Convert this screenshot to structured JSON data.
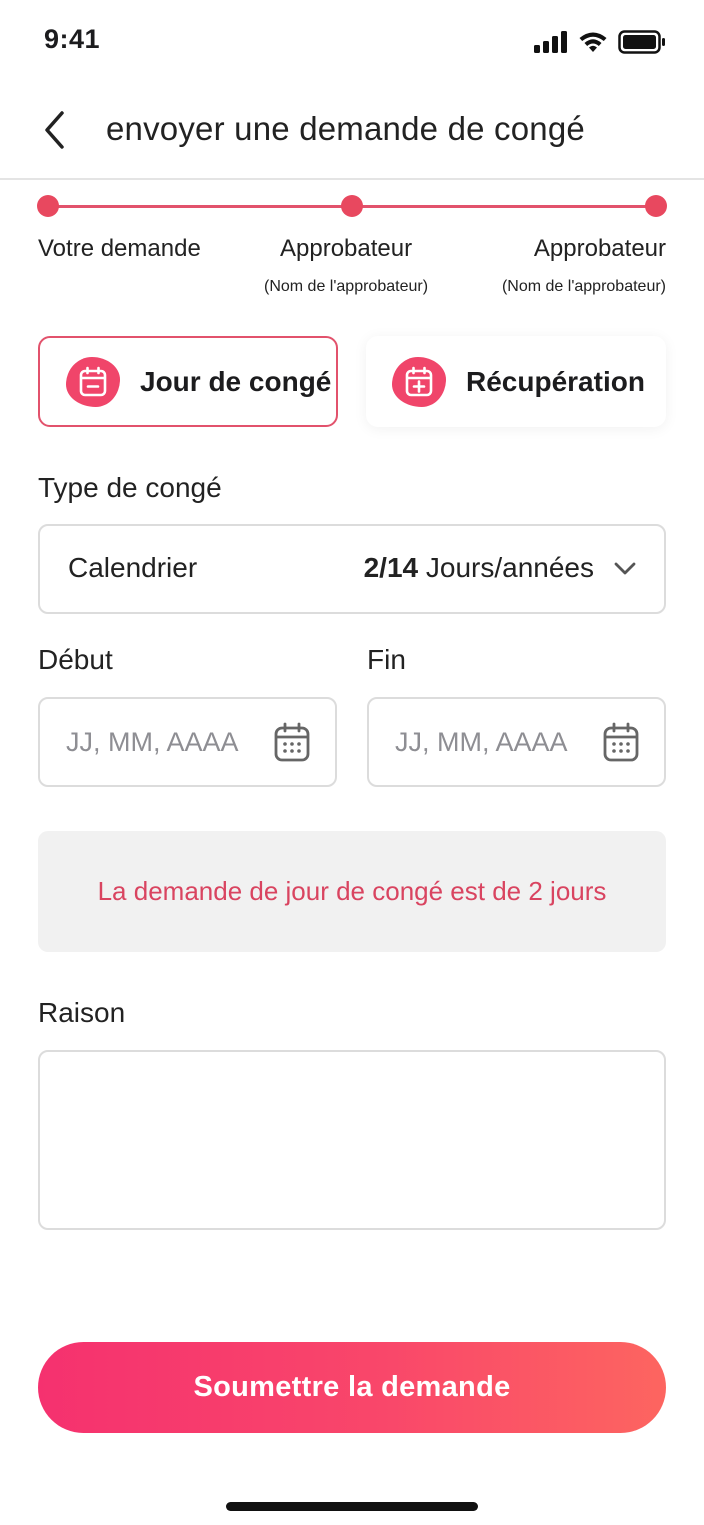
{
  "status_bar": {
    "time": "9:41",
    "icons": [
      "signal-icon",
      "wifi-icon",
      "battery-icon"
    ]
  },
  "header": {
    "title": "envoyer une demande de congé",
    "back_icon": "chevron-left-icon"
  },
  "stepper": {
    "steps": [
      {
        "label": "Votre demande",
        "sublabel": ""
      },
      {
        "label": "Approbateur",
        "sublabel": "(Nom de l'approbateur)"
      },
      {
        "label": "Approbateur",
        "sublabel": "(Nom de l'approbateur)"
      }
    ],
    "color": "#e8485f"
  },
  "leave_types": [
    {
      "label": "Jour de congé",
      "icon": "calendar-minus-icon",
      "selected": true
    },
    {
      "label": "Récupération",
      "icon": "calendar-plus-icon",
      "selected": false
    }
  ],
  "type_field": {
    "label": "Type de congé",
    "value": "Calendrier",
    "quota_count": "2/14",
    "quota_unit": "Jours/années"
  },
  "dates": {
    "start": {
      "label": "Début",
      "placeholder": "JJ, MM, AAAA"
    },
    "end": {
      "label": "Fin",
      "placeholder": "JJ, MM, AAAA"
    }
  },
  "notice": {
    "text": "La demande de jour de congé est de 2 jours"
  },
  "reason": {
    "label": "Raison",
    "value": ""
  },
  "submit": {
    "label": "Soumettre la demande"
  },
  "colors": {
    "accent": "#e8485f",
    "icon_blob": "#f0456a",
    "notice_text": "#d94460",
    "button_gradient_start": "#f5316f",
    "button_gradient_end": "#fd6560"
  }
}
